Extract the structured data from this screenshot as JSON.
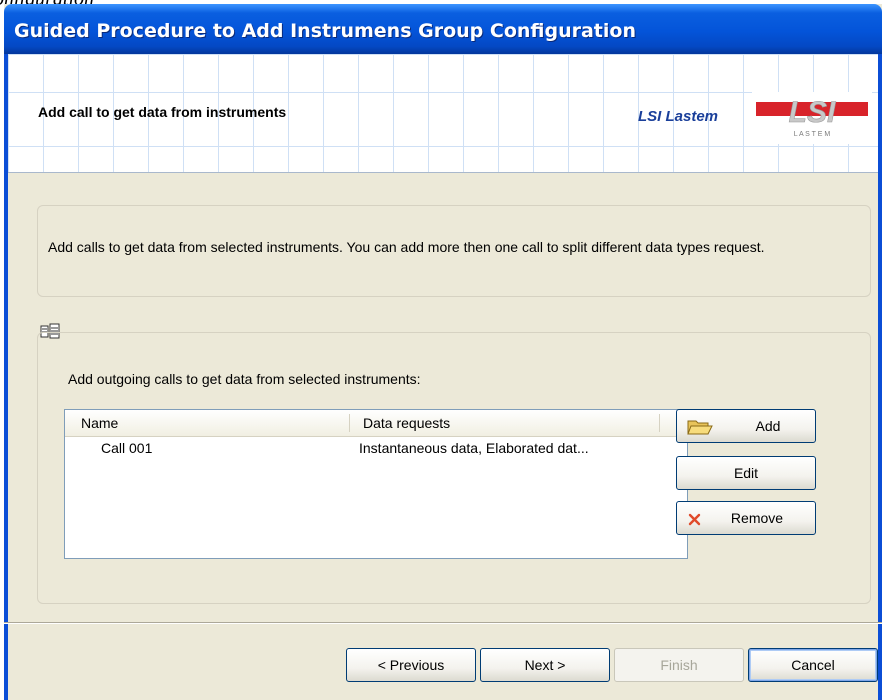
{
  "document": {
    "fragment_text": "onfiguration"
  },
  "window": {
    "title": "Guided Procedure to Add Instrumens Group Configuration"
  },
  "header": {
    "step_title": "Add call to get data from instruments",
    "brand_name": "LSI Lastem",
    "logo_text": "LSI",
    "logo_subtext": "L A S T E M"
  },
  "info": {
    "text": "Add calls to get data from selected instruments. You can add more then one call to split different data types request."
  },
  "group": {
    "caption": "Add outgoing calls to get data from selected instruments:",
    "icon": "calls-icon",
    "list": {
      "columns": [
        "Name",
        "Data requests"
      ],
      "rows": [
        {
          "name": "Call 001",
          "data_requests": "Instantaneous data, Elaborated dat..."
        }
      ]
    },
    "buttons": {
      "add": "Add",
      "edit": "Edit",
      "remove": "Remove"
    }
  },
  "footer": {
    "previous": "< Previous",
    "next": "Next >",
    "finish": "Finish",
    "cancel": "Cancel",
    "finish_disabled": true
  },
  "colors": {
    "titlebar": "#0454d9",
    "dialog_bg": "#ece9d8",
    "brand_red": "#d8232a",
    "brand_blue": "#1a3f9a"
  }
}
